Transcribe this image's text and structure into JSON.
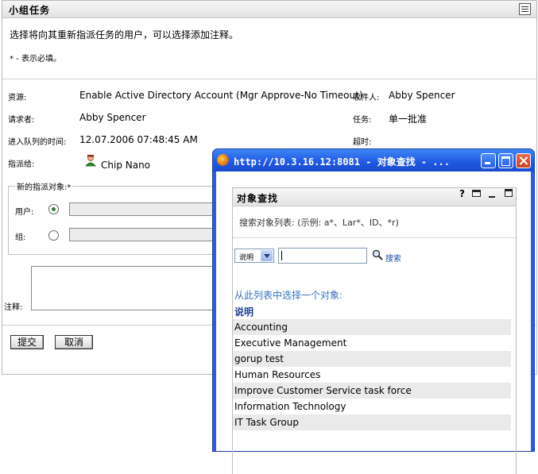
{
  "panel": {
    "title": "小组任务",
    "instruction": "选择将向其重新指派任务的用户，可以选择添加注释。",
    "required_note": "* - 表示必填。"
  },
  "details": {
    "resource_label": "资源:",
    "resource_value": "Enable Active Directory Account (Mgr Approve-No Timeout)",
    "recipient_label": "收件人:",
    "recipient_value": "Abby Spencer",
    "requester_label": "请求者:",
    "requester_value": "Abby Spencer",
    "task_label": "任务:",
    "task_value": "单一批准",
    "queued_label": "进入队列的时间:",
    "queued_value": "12.07.2006 07:48:45 AM",
    "timeout_label": "超时:",
    "assigned_label": "指派给:",
    "assigned_value": "Chip Nano"
  },
  "assign": {
    "legend": "新的指派对象:*",
    "user_label": "用户:",
    "group_label": "组:",
    "selected": "user"
  },
  "notes": {
    "label": "注释:"
  },
  "buttons": {
    "submit": "提交",
    "cancel": "取消"
  },
  "popup": {
    "window_title": "http://10.3.16.12:8081 - 对象查找 - ...",
    "panel_title": "对象查找",
    "help_icon": "?",
    "description": "搜索对象列表: (示例: a*、Lar*、ID、*r)",
    "search_attribute": "说明",
    "search_value": "",
    "search_label": "搜索",
    "list_heading": "从此列表中选择一个对象:",
    "column_header": "说明",
    "results": [
      "Accounting",
      "Executive Management",
      "gorup test",
      "Human Resources",
      "Improve Customer Service task force",
      "Information Technology",
      "IT Task Group"
    ]
  },
  "colors": {
    "titlebar": "#2a62e6",
    "link": "#1b4fa0",
    "list_heading": "#3673b8",
    "row_alt": "#eaeaea"
  }
}
